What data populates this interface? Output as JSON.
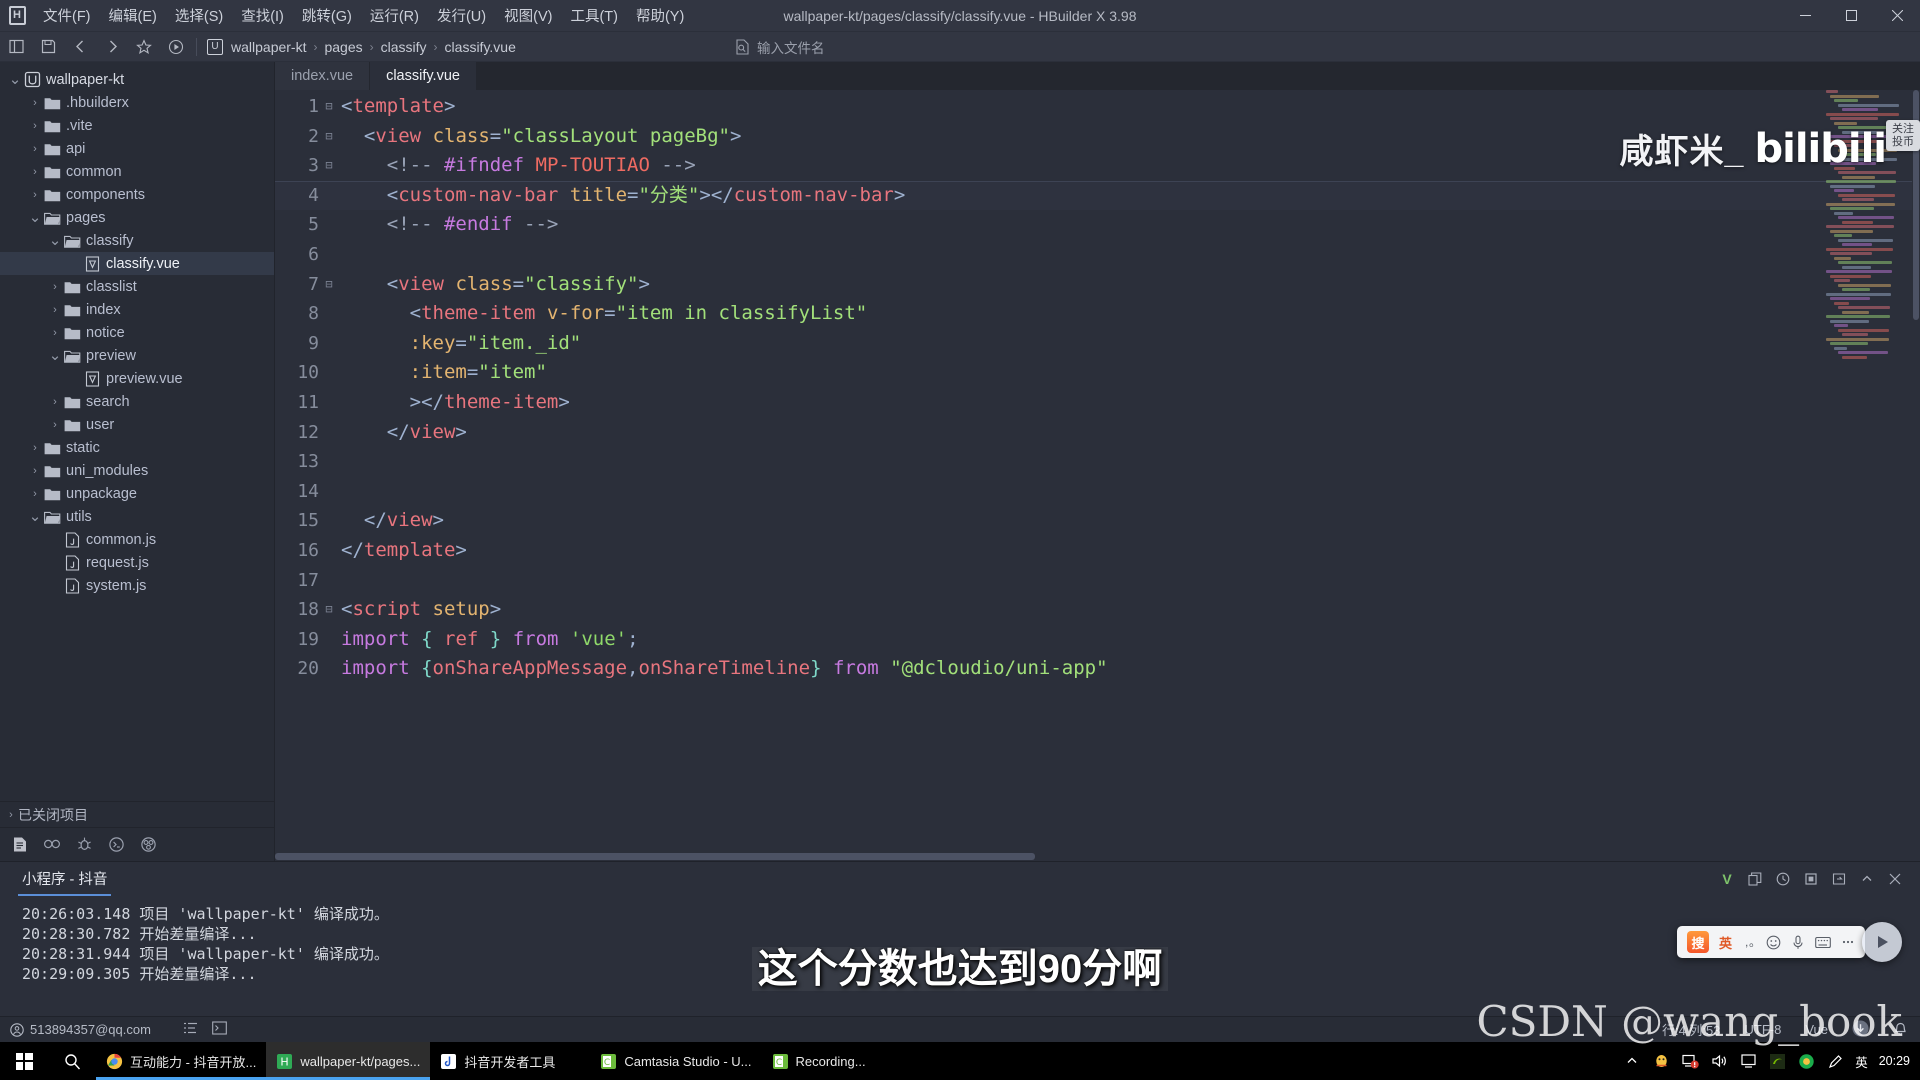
{
  "titlebar": {
    "logo_icon": "hbuilder-logo-icon",
    "window_title": "wallpaper-kt/pages/classify/classify.vue - HBuilder X 3.98",
    "menus": [
      "文件(F)",
      "编辑(E)",
      "选择(S)",
      "查找(I)",
      "跳转(G)",
      "运行(R)",
      "发行(U)",
      "视图(V)",
      "工具(T)",
      "帮助(Y)"
    ],
    "controls": [
      "minimize",
      "maximize",
      "close"
    ]
  },
  "toolbar": {
    "icons": [
      "toggle-sidebar-icon",
      "save-icon",
      "back-icon",
      "forward-icon",
      "favorite-icon",
      "run-icon"
    ],
    "breadcrumb": [
      "wallpaper-kt",
      "pages",
      "classify",
      "classify.vue"
    ],
    "filename_search_placeholder": "输入文件名"
  },
  "sidebar": {
    "tree": [
      {
        "label": "wallpaper-kt",
        "depth": 0,
        "type": "project",
        "state": "expanded",
        "selected": false
      },
      {
        "label": ".hbuilderx",
        "depth": 1,
        "type": "folder",
        "state": "collapsed",
        "selected": false
      },
      {
        "label": ".vite",
        "depth": 1,
        "type": "folder",
        "state": "collapsed",
        "selected": false
      },
      {
        "label": "api",
        "depth": 1,
        "type": "folder",
        "state": "collapsed",
        "selected": false
      },
      {
        "label": "common",
        "depth": 1,
        "type": "folder",
        "state": "collapsed",
        "selected": false
      },
      {
        "label": "components",
        "depth": 1,
        "type": "folder",
        "state": "collapsed",
        "selected": false
      },
      {
        "label": "pages",
        "depth": 1,
        "type": "folder",
        "state": "expanded",
        "selected": false
      },
      {
        "label": "classify",
        "depth": 2,
        "type": "folder",
        "state": "expanded",
        "selected": false
      },
      {
        "label": "classify.vue",
        "depth": 3,
        "type": "vue",
        "state": "leaf",
        "selected": true
      },
      {
        "label": "classlist",
        "depth": 2,
        "type": "folder",
        "state": "collapsed",
        "selected": false
      },
      {
        "label": "index",
        "depth": 2,
        "type": "folder",
        "state": "collapsed",
        "selected": false
      },
      {
        "label": "notice",
        "depth": 2,
        "type": "folder",
        "state": "collapsed",
        "selected": false
      },
      {
        "label": "preview",
        "depth": 2,
        "type": "folder",
        "state": "expanded",
        "selected": false
      },
      {
        "label": "preview.vue",
        "depth": 3,
        "type": "vue",
        "state": "leaf",
        "selected": false
      },
      {
        "label": "search",
        "depth": 2,
        "type": "folder",
        "state": "collapsed",
        "selected": false
      },
      {
        "label": "user",
        "depth": 2,
        "type": "folder",
        "state": "collapsed",
        "selected": false
      },
      {
        "label": "static",
        "depth": 1,
        "type": "folder",
        "state": "collapsed",
        "selected": false
      },
      {
        "label": "uni_modules",
        "depth": 1,
        "type": "folder",
        "state": "collapsed",
        "selected": false
      },
      {
        "label": "unpackage",
        "depth": 1,
        "type": "folder",
        "state": "collapsed",
        "selected": false
      },
      {
        "label": "utils",
        "depth": 1,
        "type": "folder",
        "state": "expanded",
        "selected": false
      },
      {
        "label": "common.js",
        "depth": 2,
        "type": "js",
        "state": "leaf",
        "selected": false
      },
      {
        "label": "request.js",
        "depth": 2,
        "type": "js",
        "state": "leaf",
        "selected": false
      },
      {
        "label": "system.js",
        "depth": 2,
        "type": "js",
        "state": "leaf",
        "selected": false
      }
    ],
    "closed_projects_label": "已关闭项目",
    "tool_icons": [
      "project-manager-icon",
      "search-icon",
      "debug-icon",
      "terminal-icon",
      "extension-icon"
    ]
  },
  "editor": {
    "tabs": [
      {
        "label": "index.vue",
        "active": false
      },
      {
        "label": "classify.vue",
        "active": true
      }
    ],
    "current_line": 4,
    "lines": [
      {
        "n": 1,
        "fold": "open",
        "current": false,
        "tokens": [
          {
            "t": "punct",
            "v": "<"
          },
          {
            "t": "tag",
            "v": "template"
          },
          {
            "t": "punct",
            "v": ">"
          }
        ]
      },
      {
        "n": 2,
        "fold": "open",
        "current": false,
        "tokens": [
          {
            "t": "plain",
            "v": "  "
          },
          {
            "t": "punct",
            "v": "<"
          },
          {
            "t": "tag",
            "v": "view"
          },
          {
            "t": "plain",
            "v": " "
          },
          {
            "t": "attr",
            "v": "class"
          },
          {
            "t": "punct",
            "v": "="
          },
          {
            "t": "str",
            "v": "\"classLayout pageBg\""
          },
          {
            "t": "punct",
            "v": ">"
          }
        ]
      },
      {
        "n": 3,
        "fold": "open",
        "current": false,
        "tokens": [
          {
            "t": "plain",
            "v": "    "
          },
          {
            "t": "cmt",
            "v": "<!-- "
          },
          {
            "t": "pre",
            "v": "#ifndef"
          },
          {
            "t": "plain",
            "v": " "
          },
          {
            "t": "mp",
            "v": "MP-TOUTIAO"
          },
          {
            "t": "cmt",
            "v": " -->"
          }
        ]
      },
      {
        "n": 4,
        "fold": "none",
        "current": true,
        "tokens": [
          {
            "t": "plain",
            "v": "    "
          },
          {
            "t": "punct",
            "v": "<"
          },
          {
            "t": "tag",
            "v": "custom-nav-bar"
          },
          {
            "t": "plain",
            "v": " "
          },
          {
            "t": "attr",
            "v": "title"
          },
          {
            "t": "punct",
            "v": "="
          },
          {
            "t": "str",
            "v": "\"分类\""
          },
          {
            "t": "punct",
            "v": "></"
          },
          {
            "t": "tag",
            "v": "custom-nav-bar"
          },
          {
            "t": "punct",
            "v": ">"
          }
        ]
      },
      {
        "n": 5,
        "fold": "none",
        "current": false,
        "tokens": [
          {
            "t": "plain",
            "v": "    "
          },
          {
            "t": "cmt",
            "v": "<!-- "
          },
          {
            "t": "pre",
            "v": "#endif"
          },
          {
            "t": "cmt",
            "v": " -->"
          }
        ]
      },
      {
        "n": 6,
        "fold": "none",
        "current": false,
        "tokens": []
      },
      {
        "n": 7,
        "fold": "open",
        "current": false,
        "tokens": [
          {
            "t": "plain",
            "v": "    "
          },
          {
            "t": "punct",
            "v": "<"
          },
          {
            "t": "tag",
            "v": "view"
          },
          {
            "t": "plain",
            "v": " "
          },
          {
            "t": "attr",
            "v": "class"
          },
          {
            "t": "punct",
            "v": "="
          },
          {
            "t": "str",
            "v": "\"classify\""
          },
          {
            "t": "punct",
            "v": ">"
          }
        ]
      },
      {
        "n": 8,
        "fold": "none",
        "current": false,
        "tokens": [
          {
            "t": "plain",
            "v": "      "
          },
          {
            "t": "punct",
            "v": "<"
          },
          {
            "t": "tag",
            "v": "theme-item"
          },
          {
            "t": "plain",
            "v": " "
          },
          {
            "t": "attr",
            "v": "v-for"
          },
          {
            "t": "punct",
            "v": "="
          },
          {
            "t": "str",
            "v": "\"item in classifyList\""
          }
        ]
      },
      {
        "n": 9,
        "fold": "none",
        "current": false,
        "tokens": [
          {
            "t": "plain",
            "v": "      "
          },
          {
            "t": "attr",
            "v": ":key"
          },
          {
            "t": "punct",
            "v": "="
          },
          {
            "t": "str",
            "v": "\"item._id\""
          }
        ]
      },
      {
        "n": 10,
        "fold": "none",
        "current": false,
        "tokens": [
          {
            "t": "plain",
            "v": "      "
          },
          {
            "t": "attr",
            "v": ":item"
          },
          {
            "t": "punct",
            "v": "="
          },
          {
            "t": "str",
            "v": "\"item\""
          }
        ]
      },
      {
        "n": 11,
        "fold": "none",
        "current": false,
        "tokens": [
          {
            "t": "plain",
            "v": "      "
          },
          {
            "t": "punct",
            "v": "></"
          },
          {
            "t": "tag",
            "v": "theme-item"
          },
          {
            "t": "punct",
            "v": ">"
          }
        ]
      },
      {
        "n": 12,
        "fold": "none",
        "current": false,
        "tokens": [
          {
            "t": "plain",
            "v": "    "
          },
          {
            "t": "punct",
            "v": "</"
          },
          {
            "t": "tag",
            "v": "view"
          },
          {
            "t": "punct",
            "v": ">"
          }
        ]
      },
      {
        "n": 13,
        "fold": "none",
        "current": false,
        "tokens": []
      },
      {
        "n": 14,
        "fold": "none",
        "current": false,
        "tokens": []
      },
      {
        "n": 15,
        "fold": "none",
        "current": false,
        "tokens": [
          {
            "t": "plain",
            "v": "  "
          },
          {
            "t": "punct",
            "v": "</"
          },
          {
            "t": "tag",
            "v": "view"
          },
          {
            "t": "punct",
            "v": ">"
          }
        ]
      },
      {
        "n": 16,
        "fold": "none",
        "current": false,
        "tokens": [
          {
            "t": "punct",
            "v": "</"
          },
          {
            "t": "tag",
            "v": "template"
          },
          {
            "t": "punct",
            "v": ">"
          }
        ]
      },
      {
        "n": 17,
        "fold": "none",
        "current": false,
        "tokens": []
      },
      {
        "n": 18,
        "fold": "open",
        "current": false,
        "tokens": [
          {
            "t": "punct",
            "v": "<"
          },
          {
            "t": "tag",
            "v": "script"
          },
          {
            "t": "plain",
            "v": " "
          },
          {
            "t": "attr",
            "v": "setup"
          },
          {
            "t": "punct",
            "v": ">"
          }
        ]
      },
      {
        "n": 19,
        "fold": "none",
        "current": false,
        "tokens": [
          {
            "t": "kw",
            "v": "import"
          },
          {
            "t": "plain",
            "v": " "
          },
          {
            "t": "br",
            "v": "{"
          },
          {
            "t": "plain",
            "v": " "
          },
          {
            "t": "var",
            "v": "ref"
          },
          {
            "t": "plain",
            "v": " "
          },
          {
            "t": "br",
            "v": "}"
          },
          {
            "t": "plain",
            "v": " "
          },
          {
            "t": "kw",
            "v": "from"
          },
          {
            "t": "plain",
            "v": " "
          },
          {
            "t": "sq",
            "v": "'vue'"
          },
          {
            "t": "punct",
            "v": ";"
          }
        ]
      },
      {
        "n": 20,
        "fold": "none",
        "current": false,
        "tokens": [
          {
            "t": "kw",
            "v": "import"
          },
          {
            "t": "plain",
            "v": " "
          },
          {
            "t": "br",
            "v": "{"
          },
          {
            "t": "var",
            "v": "onShareAppMessage"
          },
          {
            "t": "punct",
            "v": ","
          },
          {
            "t": "var",
            "v": "onShareTimeline"
          },
          {
            "t": "br",
            "v": "}"
          },
          {
            "t": "plain",
            "v": " "
          },
          {
            "t": "kw",
            "v": "from"
          },
          {
            "t": "plain",
            "v": " "
          },
          {
            "t": "str",
            "v": "\"@dcloudio/uni-app\""
          }
        ]
      }
    ],
    "watermark_text": "咸虾米_",
    "watermark_brand": "bilibili",
    "watermark_btn_line1": "关注",
    "watermark_btn_line2": "投币"
  },
  "console": {
    "tab_label": "小程序 - 抖音",
    "actions": [
      "v-icon",
      "copy-icon",
      "clock-icon",
      "stop-icon",
      "export-icon",
      "collapse-icon",
      "close-icon"
    ],
    "logs": [
      "20:26:03.148 项目 'wallpaper-kt' 编译成功。",
      "20:28:30.782 开始差量编译...",
      "20:28:31.944 项目 'wallpaper-kt' 编译成功。",
      "20:29:09.305 开始差量编译..."
    ]
  },
  "statusbar": {
    "account": "513894357@qq.com",
    "account_icon": "user-circle-icon",
    "icons": [
      "list-icon",
      "terminal-icon"
    ],
    "cursor_position": "行:4 列:53",
    "encoding": "UTF-8",
    "language": "Vue",
    "right_icons": [
      "download-icon",
      "bell-icon"
    ]
  },
  "taskbar": {
    "start_icon": "windows-start-icon",
    "search_icon": "search-icon",
    "tasks": [
      {
        "label": "互动能力 - 抖音开放...",
        "icon": "chrome-icon",
        "active": false,
        "open": true
      },
      {
        "label": "wallpaper-kt/pages...",
        "icon": "hbuilder-icon",
        "active": true,
        "open": true
      },
      {
        "label": "抖音开发者工具",
        "icon": "douyin-devtools-icon",
        "active": false,
        "open": false
      },
      {
        "label": "Camtasia Studio - U...",
        "icon": "camtasia-icon",
        "active": false,
        "open": false
      },
      {
        "label": "Recording...",
        "icon": "camtasia-icon",
        "active": false,
        "open": false
      }
    ],
    "tray_icons": [
      "chevron-up-icon",
      "qq-icon",
      "network-warning-icon",
      "volume-icon",
      "display-icon",
      "nvidia-icon",
      "360-icon",
      "ime-pen-icon"
    ],
    "ime_label": "英",
    "clock": "20:29"
  },
  "overlays": {
    "subtitle": "这个分数也达到90分啊",
    "csdn_watermark": "CSDN @wang_book",
    "ime_bar": {
      "logo": "搜",
      "lang": "英",
      "items": [
        "comma-icon",
        "emoji-icon",
        "mic-icon",
        "keyboard-icon",
        "more-icon"
      ]
    }
  }
}
